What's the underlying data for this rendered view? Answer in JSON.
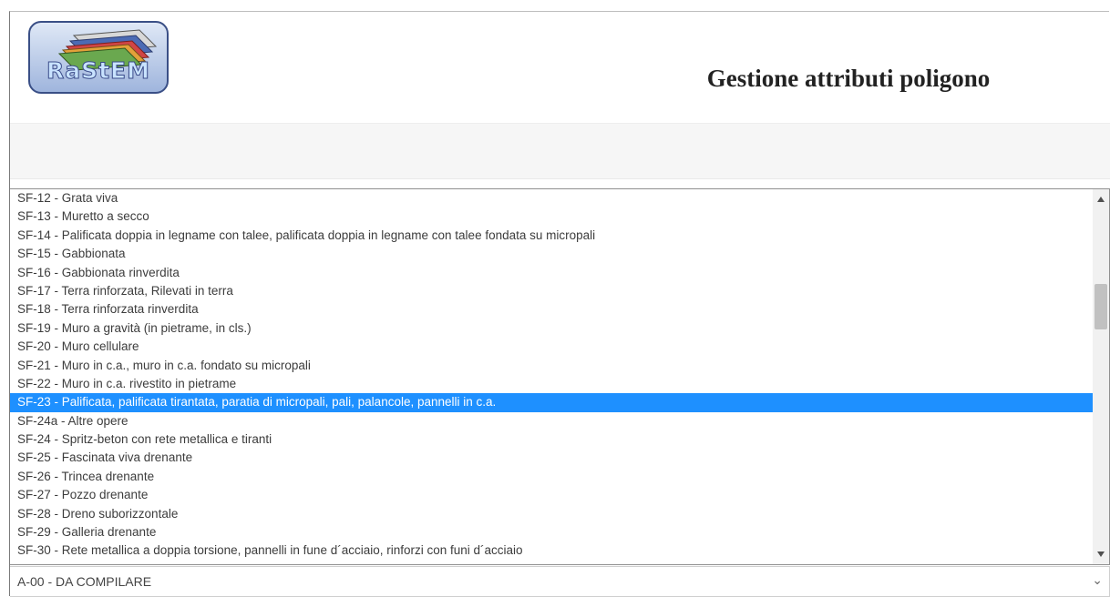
{
  "header": {
    "logo_text": "RaStEM",
    "title": "Gestione attributi poligono"
  },
  "listbox": {
    "items": [
      "SF-12 - Grata viva",
      "SF-13 - Muretto a secco",
      "SF-14 - Palificata doppia in legname con talee, palificata doppia in legname con talee fondata su micropali",
      "SF-15 - Gabbionata",
      "SF-16 - Gabbionata rinverdita",
      "SF-17 - Terra rinforzata, Rilevati in terra",
      "SF-18 - Terra rinforzata rinverdita",
      "SF-19 - Muro a gravità (in pietrame, in cls.)",
      "SF-20 - Muro cellulare",
      "SF-21 - Muro in c.a., muro in c.a. fondato su micropali",
      "SF-22 - Muro in c.a. rivestito in pietrame",
      "SF-23 - Palificata, palificata tirantata, paratia di micropali, pali, palancole, pannelli in c.a.",
      "SF-24a - Altre opere",
      "SF-24 - Spritz-beton con rete metallica e tiranti",
      "SF-25 - Fascinata viva drenante",
      "SF-26 - Trincea drenante",
      "SF-27 - Pozzo drenante",
      "SF-28 - Dreno suborizzontale",
      "SF-29 - Galleria drenante",
      "SF-30 - Rete metallica a doppia torsione, pannelli in fune d´acciaio, rinforzi con funi d´acciaio"
    ],
    "selected_index": 11
  },
  "select": {
    "value": "A-00 - DA COMPILARE"
  },
  "colors": {
    "selection": "#1e90ff",
    "text": "#3c3c3c"
  }
}
